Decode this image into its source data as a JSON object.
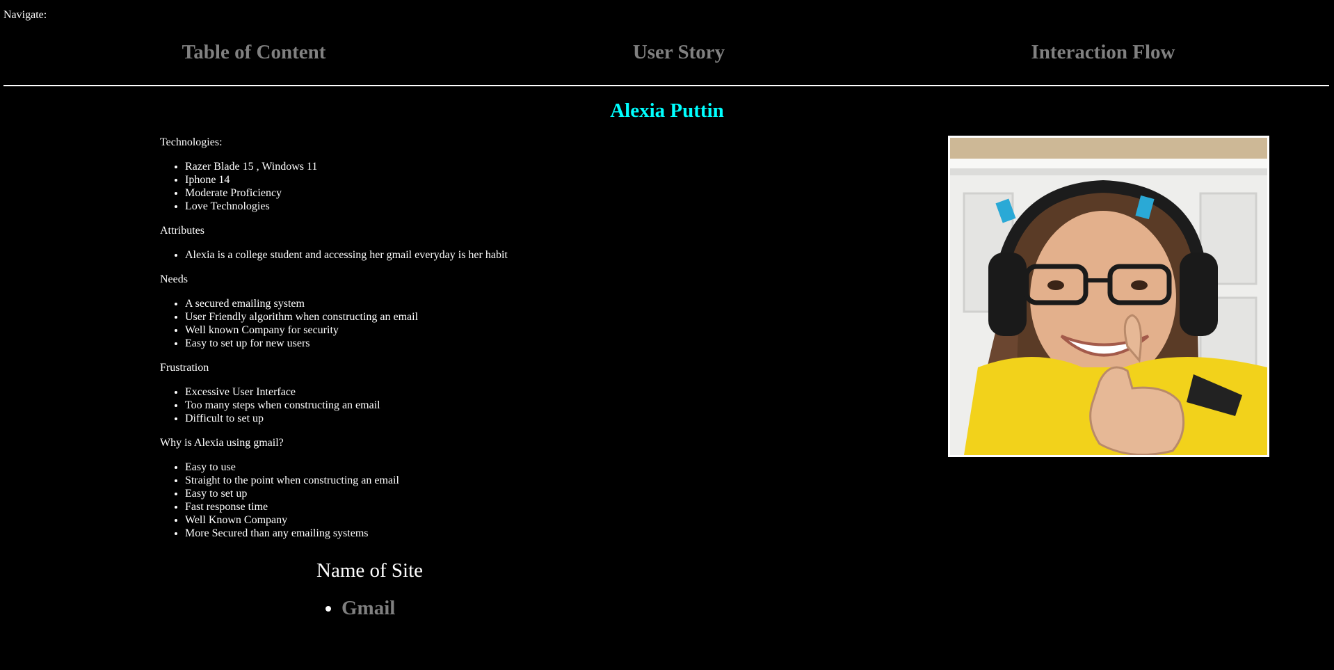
{
  "nav": {
    "label": "Navigate:",
    "links": [
      {
        "label": "Table of Content"
      },
      {
        "label": "User Story"
      },
      {
        "label": "Interaction Flow"
      }
    ]
  },
  "persona": {
    "name": "Alexia Puttin",
    "photo_alt": "Portrait of Alexia Puttin wearing headset and yellow shirt giving a thumbs up"
  },
  "sections": [
    {
      "title": "Technologies:",
      "items": [
        "Razer Blade 15 , Windows 11",
        "Iphone 14",
        "Moderate Proficiency",
        "Love Technologies"
      ]
    },
    {
      "title": "Attributes",
      "items": [
        "Alexia is a college student and accessing her gmail everyday is her habit"
      ]
    },
    {
      "title": "Needs",
      "items": [
        "A secured emailing system",
        "User Friendly algorithm when constructing an email",
        "Well known Company for security",
        "Easy to set up for new users"
      ]
    },
    {
      "title": "Frustration",
      "items": [
        "Excessive User Interface",
        "Too many steps when constructing an email",
        "Difficult to set up"
      ]
    },
    {
      "title": "Why is Alexia using gmail?",
      "items": [
        "Easy to use",
        "Straight to the point when constructing an email",
        "Easy to set up",
        "Fast response time",
        "Well Known Company",
        "More Secured than any emailing systems"
      ]
    }
  ],
  "site": {
    "title": "Name of Site",
    "links": [
      {
        "label": "Gmail"
      }
    ]
  },
  "colors": {
    "background": "#000000",
    "text": "#ffffff",
    "name_accent": "#00ffff",
    "link": "#808080"
  }
}
